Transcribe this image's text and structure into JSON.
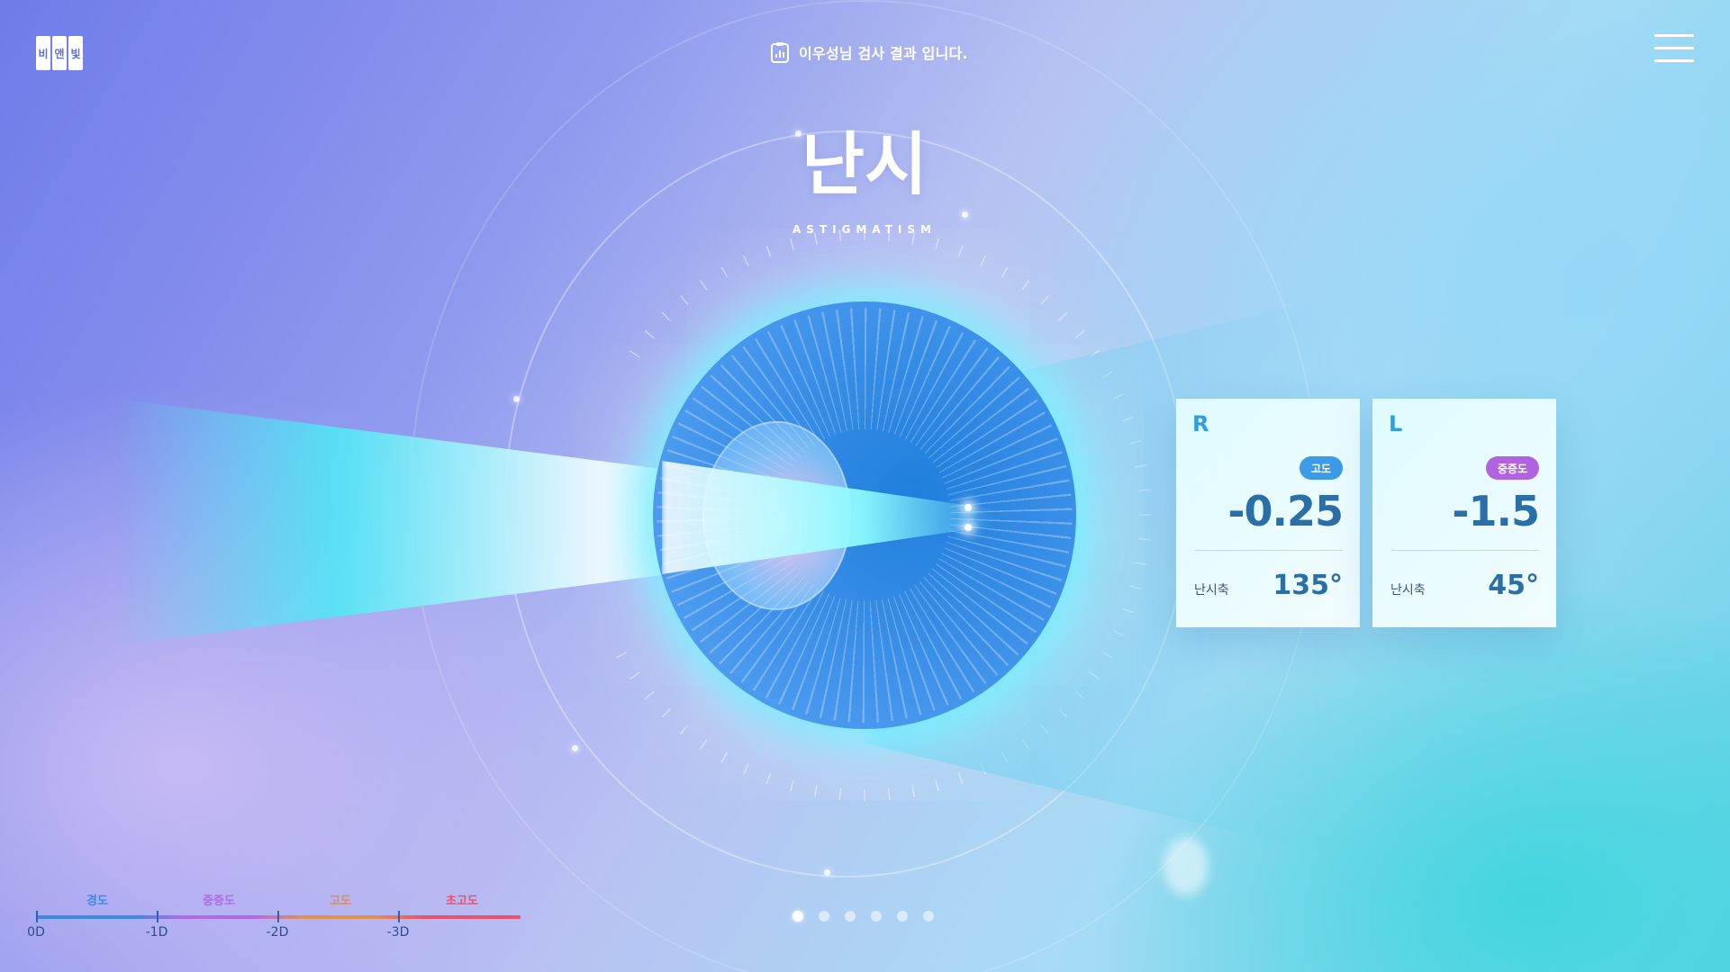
{
  "header": {
    "logo_chars": [
      "비",
      "앤",
      "빛"
    ],
    "result_text": "이우성님 검사 결과 입니다."
  },
  "main": {
    "title": "난시",
    "subtitle": "ASTIGMATISM"
  },
  "cards": [
    {
      "eye": "R",
      "badge": "고도",
      "badge_color": "#3b9be6",
      "value": "-0.25",
      "axis_label": "난시축",
      "axis_value": "135°"
    },
    {
      "eye": "L",
      "badge": "중증도",
      "badge_color": "#b062e0",
      "value": "-1.5",
      "axis_label": "난시축",
      "axis_value": "45°"
    }
  ],
  "scale": {
    "categories": [
      {
        "label": "경도",
        "color": "#3a8ae6"
      },
      {
        "label": "중증도",
        "color": "#b06ae8"
      },
      {
        "label": "고도",
        "color": "#e08a4a"
      },
      {
        "label": "초고도",
        "color": "#e8506b"
      }
    ],
    "ticks": [
      "0D",
      "-1D",
      "-2D",
      "-3D"
    ]
  },
  "pager": {
    "count": 6,
    "active": 1
  }
}
